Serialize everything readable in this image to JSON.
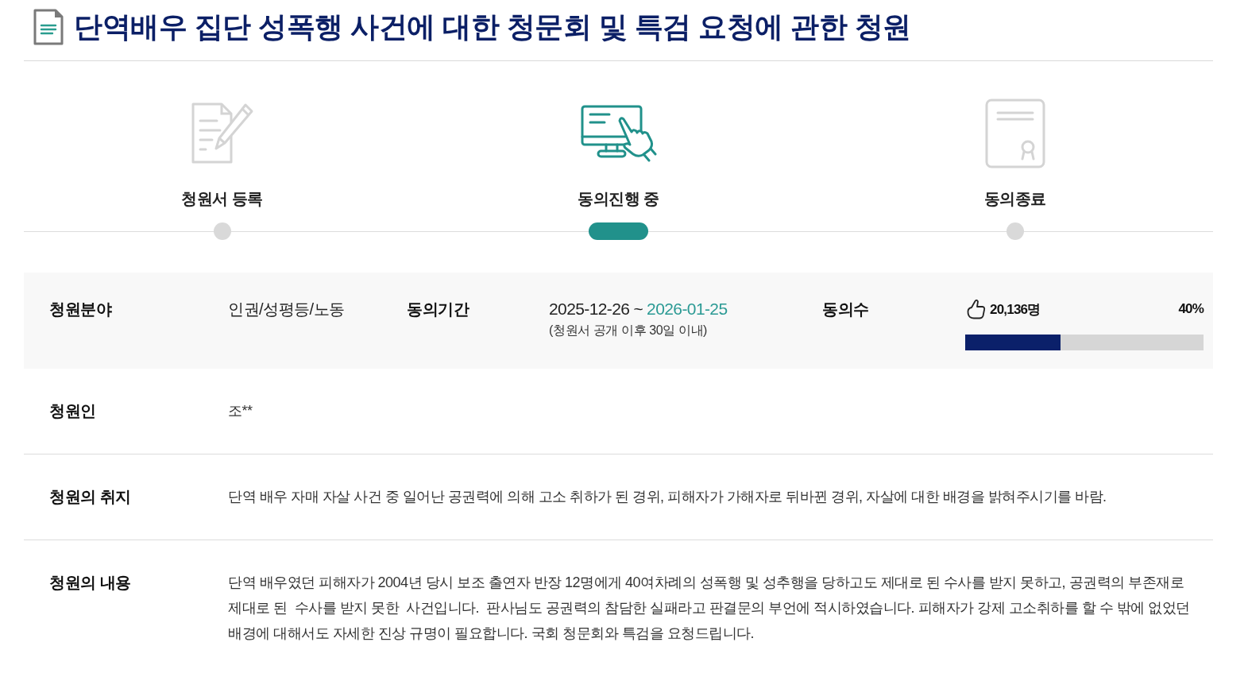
{
  "title": {
    "text": "단역배우 집단 성폭행 사건에 대한 청문회 및 특검 요청에 관한 청원"
  },
  "steps": [
    {
      "label": "청원서 등록",
      "selected": false
    },
    {
      "label": "동의진행 중",
      "selected": true
    },
    {
      "label": "동의종료",
      "selected": false
    }
  ],
  "summary": {
    "category": {
      "label": "청원분야",
      "value": "인권/성평등/노동"
    },
    "period": {
      "label": "동의기간",
      "start": "2025-12-26",
      "separator": "~",
      "end": "2026-01-25",
      "note": "(청원서 공개 이후 30일 이내)"
    },
    "agreements": {
      "label": "동의수",
      "count": "20,136명",
      "percent": "40%",
      "level": 0.4
    }
  },
  "rows": [
    {
      "label": "청원인",
      "value": "조**"
    },
    {
      "label": "청원의 취지",
      "value": "단역 배우 자매 자살 사건 중 일어난 공권력에 의해 고소 취하가 된 경위, 피해자가 가해자로 뒤바뀐 경위, 자살에 대한 배경을 밝혀주시기를 바람."
    },
    {
      "label": "청원의 내용",
      "value": "단역 배우였던 피해자가 2004년 당시 보조 출연자 반장 12명에게 40여차례의 성폭행 및 성추행을 당하고도 제대로 된 수사를 받지 못하고, 공권력의 부존재로 제대로 된  수사를 받지 못한  사건입니다.  판사님도 공권력의 참담한 실패라고 판결문의 부언에 적시하였습니다. 피해자가 강제 고소취하를 할 수 밖에 없었던 배경에 대해서도 자세한 진상 규명이 필요합니다. 국회 청문회와 특검을 요청드립니다."
    }
  ]
}
